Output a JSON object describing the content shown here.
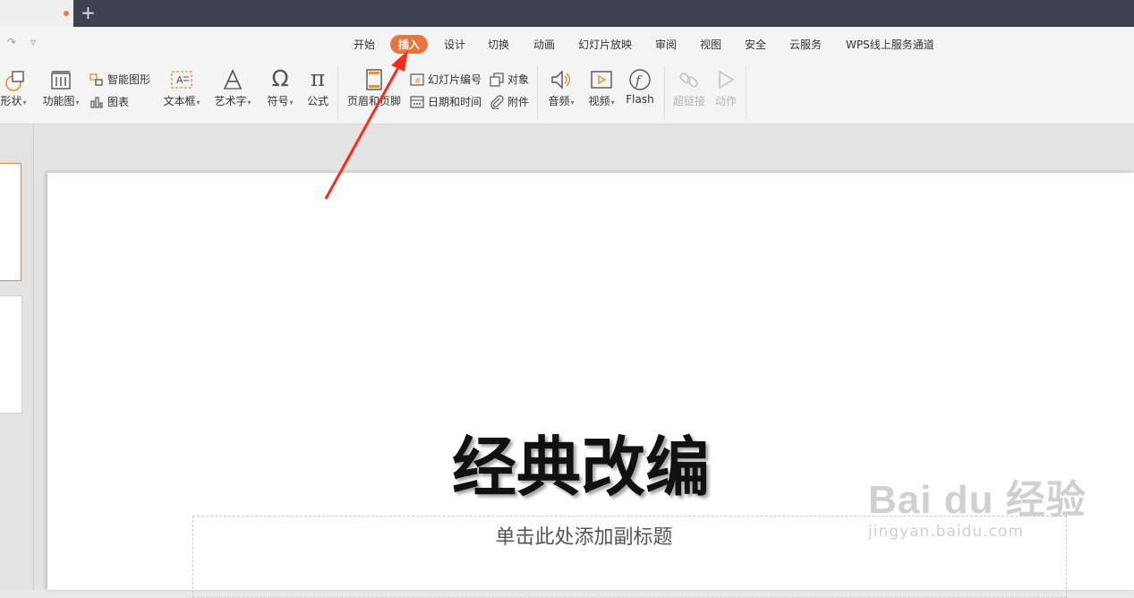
{
  "tabstrip": {
    "new_tab_label": "+"
  },
  "quick_access": {
    "redo_icon": "↷",
    "dropdown_icon": "▿"
  },
  "menu": {
    "items": [
      "开始",
      "插入",
      "设计",
      "切换",
      "动画",
      "幻灯片放映",
      "审阅",
      "视图",
      "安全",
      "云服务",
      "WPS线上服务通道"
    ],
    "active_index": 1
  },
  "ribbon": {
    "shape": "形状",
    "smartart": "功能图",
    "smart_graphic": "智能图形",
    "chart": "图表",
    "textbox": "文本框",
    "wordart": "艺术字",
    "symbol": "符号",
    "formula": "公式",
    "header_footer": "页眉和页脚",
    "slide_number": "幻灯片编号",
    "object": "对象",
    "date_time": "日期和时间",
    "attachment": "附件",
    "audio": "音频",
    "video": "视频",
    "flash": "Flash",
    "hyperlink": "超链接",
    "action": "动作",
    "symbol_glyph": "Ω",
    "formula_glyph": "π"
  },
  "slide": {
    "title": "经典改编",
    "subtitle_placeholder": "单击此处添加副标题"
  },
  "watermark": {
    "brand": "Bai du 经验",
    "url": "jingyan.baidu.com"
  },
  "colors": {
    "accent": "#e7763d",
    "arrow": "#ff2a1a",
    "tab_bar": "#3e4150"
  }
}
